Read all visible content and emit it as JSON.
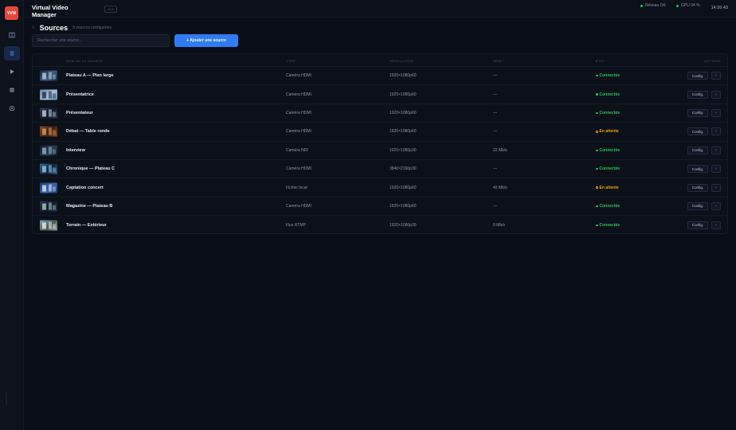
{
  "app": {
    "logo_text": "VVM",
    "title": "Virtual Video Manager",
    "version": "v2.4",
    "sidebar_footer": "build 24.1"
  },
  "sidebar": {
    "items": [
      {
        "icon": "dashboard-icon",
        "active": false
      },
      {
        "icon": "list-icon",
        "active": true
      },
      {
        "icon": "play-icon",
        "active": false
      },
      {
        "icon": "stack-icon",
        "active": false
      },
      {
        "icon": "broadcast-icon",
        "active": false
      }
    ]
  },
  "status": {
    "network": "Réseau OK",
    "gpu": "GPU 34 %",
    "time": "14:26:43"
  },
  "page": {
    "home_icon": "⌂",
    "title": "Sources",
    "subtitle": "9 sources configurées"
  },
  "toolbar": {
    "search_placeholder": "Rechercher une source...",
    "add_label": "+ Ajouter une source"
  },
  "table": {
    "headers": {
      "name": "Nom de la source",
      "type": "Type",
      "resolution": "Résolution",
      "bitrate": "Débit",
      "state": "État",
      "actions": "Actions"
    },
    "config_label": "Config.",
    "more_label": "›",
    "rows": [
      {
        "name": "Plateau A — Plan large",
        "type": "Caméra HDMI",
        "resolution": "1920×1080p60",
        "bitrate": "—",
        "state": "Connectée",
        "state_kind": "ok",
        "thumb": [
          "#1b2a40",
          "#c9d2e0",
          "#3d5a86"
        ]
      },
      {
        "name": "Présentatrice",
        "type": "Caméra HDMI",
        "resolution": "1920×1080p60",
        "bitrate": "—",
        "state": "Connectée",
        "state_kind": "ok",
        "thumb": [
          "#5f86b5",
          "#1a2535",
          "#a8bfd8"
        ]
      },
      {
        "name": "Présentateur",
        "type": "Caméra HDMI",
        "resolution": "1920×1080p60",
        "bitrate": "—",
        "state": "Connectée",
        "state_kind": "ok",
        "thumb": [
          "#2c3c55",
          "#d2d8e2",
          "#111a29"
        ]
      },
      {
        "name": "Débat — Table ronde",
        "type": "Caméra HDMI",
        "resolution": "1920×1080p60",
        "bitrate": "—",
        "state": "En attente",
        "state_kind": "wait",
        "thumb": [
          "#8a4b20",
          "#e0a060",
          "#3a2015"
        ]
      },
      {
        "name": "Interview",
        "type": "Caméra NDI",
        "resolution": "1920×1080p30",
        "bitrate": "22 Mb/s",
        "state": "Connectée",
        "state_kind": "ok",
        "thumb": [
          "#121a26",
          "#9fb6cc",
          "#2b3e57"
        ]
      },
      {
        "name": "Chronique — Plateau C",
        "type": "Caméra HDMI",
        "resolution": "3840×2160p30",
        "bitrate": "—",
        "state": "Connectée",
        "state_kind": "ok",
        "thumb": [
          "#2d6aa0",
          "#9fd0f0",
          "#0f2238"
        ]
      },
      {
        "name": "Captation concert",
        "type": "Fichier local",
        "resolution": "1920×1080p60",
        "bitrate": "45 Mb/s",
        "state": "En attente",
        "state_kind": "wait",
        "thumb": [
          "#1d3a70",
          "#e8eef8",
          "#3a66b0"
        ]
      },
      {
        "name": "Magazine — Plateau B",
        "type": "Caméra HDMI",
        "resolution": "1920×1080p60",
        "bitrate": "—",
        "state": "Connectée",
        "state_kind": "ok",
        "thumb": [
          "#253247",
          "#c0cad8",
          "#121b29"
        ]
      },
      {
        "name": "Terrain — Extérieur",
        "type": "Flux RTMP",
        "resolution": "1920×1080p30",
        "bitrate": "8 Mb/s",
        "state": "Connectée",
        "state_kind": "ok",
        "thumb": [
          "#8aa0b8",
          "#f0f2f5",
          "#4a5a48"
        ]
      }
    ]
  }
}
